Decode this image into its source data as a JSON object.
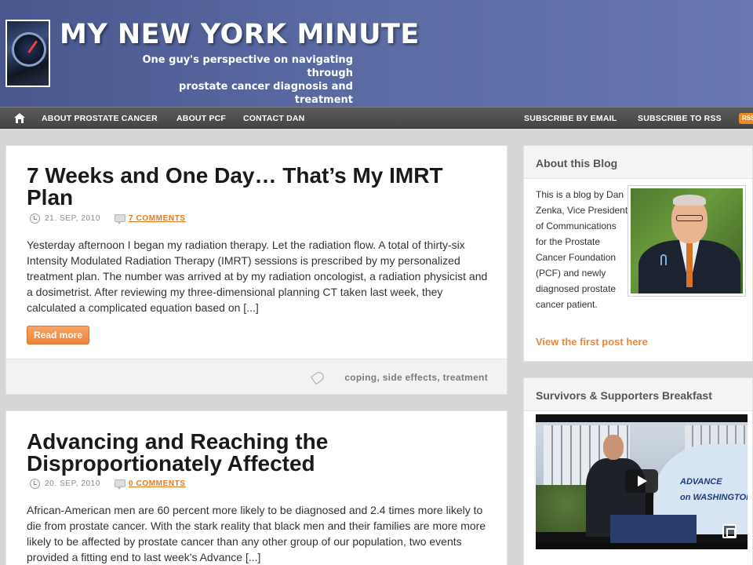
{
  "header": {
    "title": "MY NEW YORK MINUTE",
    "tagline_line1": "One guy's perspective on navigating through",
    "tagline_line2": "prostate cancer diagnosis and treatment"
  },
  "nav": {
    "left": [
      "ABOUT PROSTATE CANCER",
      "ABOUT PCF",
      "CONTACT DAN"
    ],
    "right": [
      "SUBSCRIBE BY EMAIL",
      "SUBSCRIBE TO RSS"
    ],
    "rss_badge": "RSS"
  },
  "posts": [
    {
      "title": "7 Weeks and One Day… That’s My IMRT Plan",
      "date": "21. SEP, 2010",
      "comments": "7 COMMENTS",
      "excerpt": "Yesterday afternoon I began my radiation therapy.  Let the radiation flow. A total of thirty-six Intensity Modulated  Radiation Therapy (IMRT) sessions is prescribed by my personalized treatment plan.  The number was arrived at by my radiation oncologist, a radiation physicist and a dosimetrist.  After reviewing my three-dimensional planning CT taken last week, they calculated a complicated equation based on [...]",
      "read_more": "Read more",
      "tags": "coping, side effects, treatment"
    },
    {
      "title": "Advancing and Reaching the Disproportionately Affected",
      "date": "20. SEP, 2010",
      "comments": "0 COMMENTS",
      "excerpt": "African-American men are 60 percent more likely to be diagnosed and 2.4 times more likely to die from prostate cancer. With the stark reality that black men and their families are more more likely to be affected by prostate cancer than any other group of our population, two events provided a fitting end to last week's Advance [...]"
    }
  ],
  "sidebar": {
    "about": {
      "title": "About this Blog",
      "text": "This is a blog by Dan Zenka, Vice President of Communications for the Prostate Cancer Foundation (PCF) and newly diagnosed prostate cancer patient.",
      "link": "View the first post here"
    },
    "video_widget": {
      "title": "Survivors & Supporters Breakfast",
      "banner_line1": "ADVANCE",
      "banner_line2": "on WASHINGTON"
    }
  },
  "colors": {
    "header_blue": "#5a6aa2",
    "accent_orange": "#ec8638",
    "nav_bg": "#4c4c4c"
  }
}
